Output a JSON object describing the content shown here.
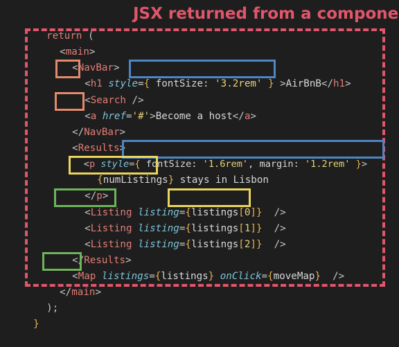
{
  "caption": "JSX returned from a component",
  "colors": {
    "background": "#1e1e1f",
    "tag": "#e47d76",
    "attr": "#7dc3d6",
    "string": "#e6d27a",
    "brace": "#e6b450",
    "text": "#d8d8d8",
    "dashed_frame": "#e0566a",
    "box_orange": "#e58a6b",
    "box_blue": "#4d86c5",
    "box_yellow": "#ecd55c",
    "box_green": "#6fb35a"
  },
  "code": {
    "l0": {
      "kw": "return",
      "rest": " ("
    },
    "l1": {
      "open": "<",
      "tag": "main",
      "close": ">"
    },
    "l2": {
      "open": "<",
      "tag": "NavBar",
      "close": ">"
    },
    "l3": {
      "open": "<",
      "tag": "h1",
      "sp": " ",
      "attr": "style",
      "eq": "=",
      "lb": "{",
      "body1": " fontSize: ",
      "str": "'3.2rem'",
      "body2": " ",
      "rb": "}",
      "after": " ",
      "gt": ">",
      "text": "AirBnB",
      "endopen": "</",
      "endtag": "h1",
      "endclose": ">"
    },
    "l4": {
      "open": "<",
      "tag": "Search",
      "selfclose": " />"
    },
    "l5": {
      "open": "<",
      "tag": "a",
      "sp": " ",
      "attr": "href",
      "eq": "=",
      "str": "'#'",
      "gt": ">",
      "text": "Become a host",
      "endopen": "</",
      "endtag": "a",
      "endclose": ">"
    },
    "l6": {
      "open": "</",
      "tag": "NavBar",
      "close": ">"
    },
    "l7": {
      "open": "<",
      "tag": "Results",
      "close": ">"
    },
    "l8": {
      "open": "<",
      "tag": "p",
      "sp": " ",
      "attr": "style",
      "eq": "=",
      "lb": "{",
      "body1": " fontSize: ",
      "str1": "'1.6rem'",
      "comma": ", margin: ",
      "str2": "'1.2rem'",
      "body2": " ",
      "rb": "}",
      "gt": ">"
    },
    "l9": {
      "lb": "{",
      "var": "numListings",
      "rb": "}",
      "text": " stays in Lisbon"
    },
    "l10": {
      "open": "</",
      "tag": "p",
      "close": ">"
    },
    "l11": {
      "open": "<",
      "tag": "Listing",
      "sp": " ",
      "attr": "listing",
      "eq": "=",
      "lb": "{",
      "var": "listings",
      "lbr": "[",
      "idx": "0",
      "rbr": "]",
      "rb": "}",
      "selfclose": "  />"
    },
    "l12": {
      "open": "<",
      "tag": "Listing",
      "sp": " ",
      "attr": "listing",
      "eq": "=",
      "lb": "{",
      "var": "listings",
      "lbr": "[",
      "idx": "1",
      "rbr": "]",
      "rb": "}",
      "selfclose": "  />"
    },
    "l13": {
      "open": "<",
      "tag": "Listing",
      "sp": " ",
      "attr": "listing",
      "eq": "=",
      "lb": "{",
      "var": "listings",
      "lbr": "[",
      "idx": "2",
      "rbr": "]",
      "rb": "}",
      "selfclose": "  />"
    },
    "l14": {
      "open": "</",
      "tag": "Results",
      "close": ">"
    },
    "l15": {
      "open": "<",
      "tag": "Map",
      "sp": " ",
      "attr": "listings",
      "eq": "=",
      "lb": "{",
      "var": "listings",
      "rb": "}",
      "sp2": " ",
      "attr2": "onClick",
      "eq2": "=",
      "lb2": "{",
      "var2": "moveMap",
      "rb2": "}",
      "selfclose": "  />"
    },
    "l16": {
      "open": "</",
      "tag": "main",
      "close": ">"
    },
    "l17": {
      "text": ");"
    },
    "l18": {
      "text": "}"
    }
  }
}
